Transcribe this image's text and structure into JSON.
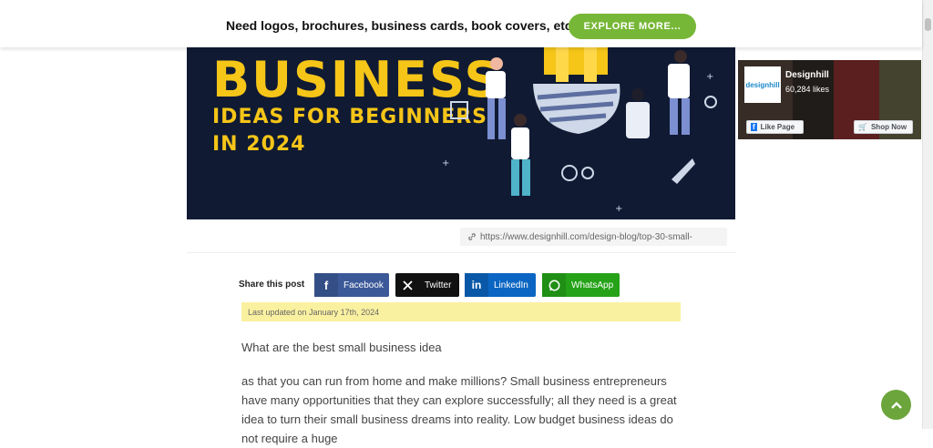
{
  "promo_bar": {
    "text": "Need logos, brochures, business cards, book covers, etc.?",
    "button_label": "EXPLORE MORE..."
  },
  "hero": {
    "title": "BUSINESS",
    "line2": "IDEAS FOR BEGINNERS",
    "line3": "IN 2024",
    "accent_color": "#f5c518",
    "background_color": "#101a33"
  },
  "image_caption": {
    "url": "https://www.designhill.com/design-blog/top-30-small-"
  },
  "share": {
    "label": "Share this post",
    "buttons": [
      {
        "label": "Facebook",
        "icon": "facebook-icon",
        "color": "#3b5998"
      },
      {
        "label": "Twitter",
        "icon": "x-icon",
        "color": "#111111"
      },
      {
        "label": "LinkedIn",
        "icon": "linkedin-icon",
        "color": "#0a66c2"
      },
      {
        "label": "WhatsApp",
        "icon": "whatsapp-icon",
        "color": "#25a218"
      }
    ]
  },
  "updated_note": "Last updated on January 17th, 2024",
  "article": {
    "question": "What are the best small business idea",
    "paragraph": "as that you can run from home and make millions? Small business entrepreneurs have many opportunities that they can explore successfully; all they need is a great idea to turn their small business dreams into reality. Low budget business ideas do not require a huge"
  },
  "facebook_widget": {
    "page_name": "Designhill",
    "likes": "60,284 likes",
    "logo_text": "designhill",
    "like_button": "Like Page",
    "shop_button": "Shop Now"
  },
  "back_to_top": {
    "icon": "chevron-up-icon",
    "color": "#6ba53b"
  }
}
